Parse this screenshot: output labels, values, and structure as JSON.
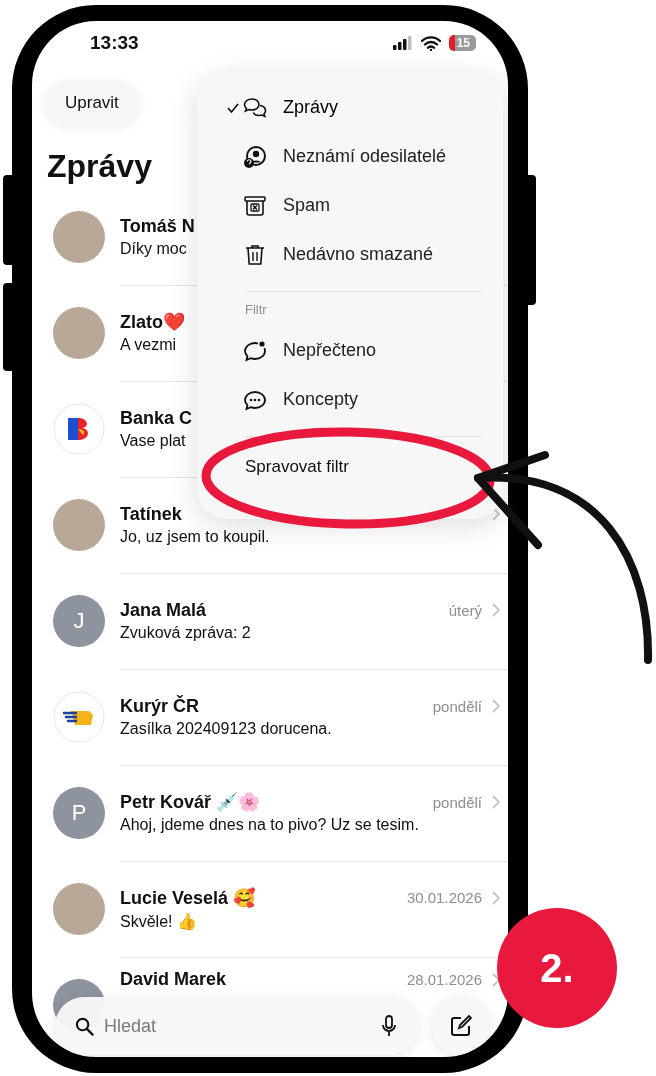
{
  "status_bar": {
    "time": "13:33",
    "battery": "15"
  },
  "edit_button": "Upravit",
  "title": "Zprávy",
  "conversations": [
    {
      "name": "Tomáš N",
      "preview": "Díky moc",
      "kind": "photo"
    },
    {
      "name": "Zlato❤️",
      "preview": "A vezmi",
      "kind": "photo"
    },
    {
      "name": "Banka C",
      "preview": "Vase plat",
      "kind": "bank"
    },
    {
      "name": "Tatínek",
      "preview": "Jo, uz jsem to koupil.",
      "kind": "photo"
    },
    {
      "name": "Jana Malá",
      "preview": "Zvuková zpráva: 2",
      "time": "úterý",
      "kind": "initial",
      "initial": "J"
    },
    {
      "name": "Kurýr ČR",
      "preview": "Zasílka 202409123 dorucena.",
      "time": "pondělí",
      "kind": "courier"
    },
    {
      "name": "Petr Kovář 💉🌸",
      "preview": "Ahoj, jdeme dnes na to pivo? Uz se tesim.",
      "time": "pondělí",
      "kind": "initial",
      "initial": "P"
    },
    {
      "name": "Lucie Veselá 🥰",
      "preview": "Skvěle! 👍",
      "time": "30.01.2026",
      "kind": "photo"
    },
    {
      "name": "David Marek",
      "time": "28.01.2026",
      "kind": "blank"
    }
  ],
  "menu": {
    "items": [
      {
        "label": "Zprávy",
        "kind": "bubbles",
        "selected": true
      },
      {
        "label": "Neznámí odesilatelé",
        "kind": "unknown",
        "selected": false
      },
      {
        "label": "Spam",
        "kind": "spam",
        "selected": false
      },
      {
        "label": "Nedávno smazané",
        "kind": "trash",
        "selected": false
      }
    ],
    "filter_heading": "Filtr",
    "filters": [
      {
        "label": "Nepřečteno",
        "kind": "unread"
      },
      {
        "label": "Koncepty",
        "kind": "drafts"
      }
    ],
    "manage": "Spravovat filtr"
  },
  "search": {
    "placeholder": "Hledat"
  },
  "annotation": {
    "step": "2."
  }
}
